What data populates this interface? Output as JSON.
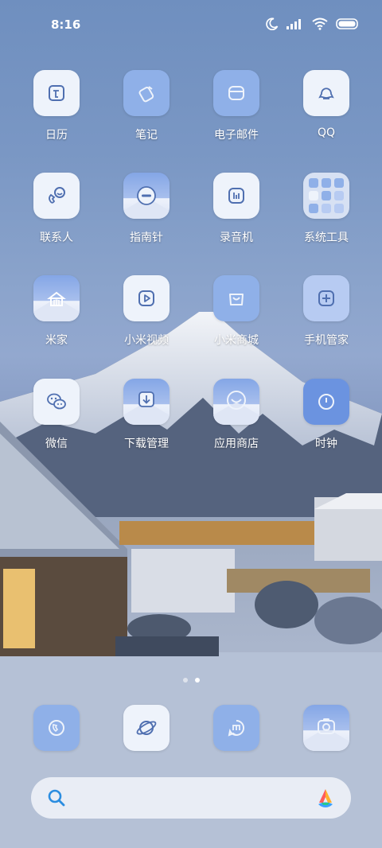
{
  "status_bar": {
    "time": "8:16",
    "icons": [
      "moon-icon",
      "signal-icon",
      "wifi-icon",
      "battery-icon"
    ]
  },
  "apps": [
    {
      "label": "日历",
      "icon": "calendar-icon"
    },
    {
      "label": "笔记",
      "icon": "note-icon"
    },
    {
      "label": "电子邮件",
      "icon": "mail-icon"
    },
    {
      "label": "QQ",
      "icon": "qq-icon"
    },
    {
      "label": "联系人",
      "icon": "contacts-icon"
    },
    {
      "label": "指南针",
      "icon": "compass-icon"
    },
    {
      "label": "录音机",
      "icon": "recorder-icon"
    },
    {
      "label": "系统工具",
      "icon": "system-tools-folder-icon"
    },
    {
      "label": "米家",
      "icon": "mijia-icon"
    },
    {
      "label": "小米视频",
      "icon": "video-icon"
    },
    {
      "label": "小米商城",
      "icon": "shop-icon"
    },
    {
      "label": "手机管家",
      "icon": "security-icon"
    },
    {
      "label": "微信",
      "icon": "wechat-icon"
    },
    {
      "label": "下载管理",
      "icon": "download-icon"
    },
    {
      "label": "应用商店",
      "icon": "app-store-icon"
    },
    {
      "label": "时钟",
      "icon": "clock-icon"
    }
  ],
  "page_indicator": {
    "pages": 2,
    "current": 2
  },
  "dock": [
    {
      "icon": "phone-icon"
    },
    {
      "icon": "browser-icon"
    },
    {
      "icon": "messages-icon"
    },
    {
      "icon": "camera-icon"
    }
  ],
  "search_bar": {
    "icon": "search-icon",
    "logo": "assistant-logo-icon"
  }
}
